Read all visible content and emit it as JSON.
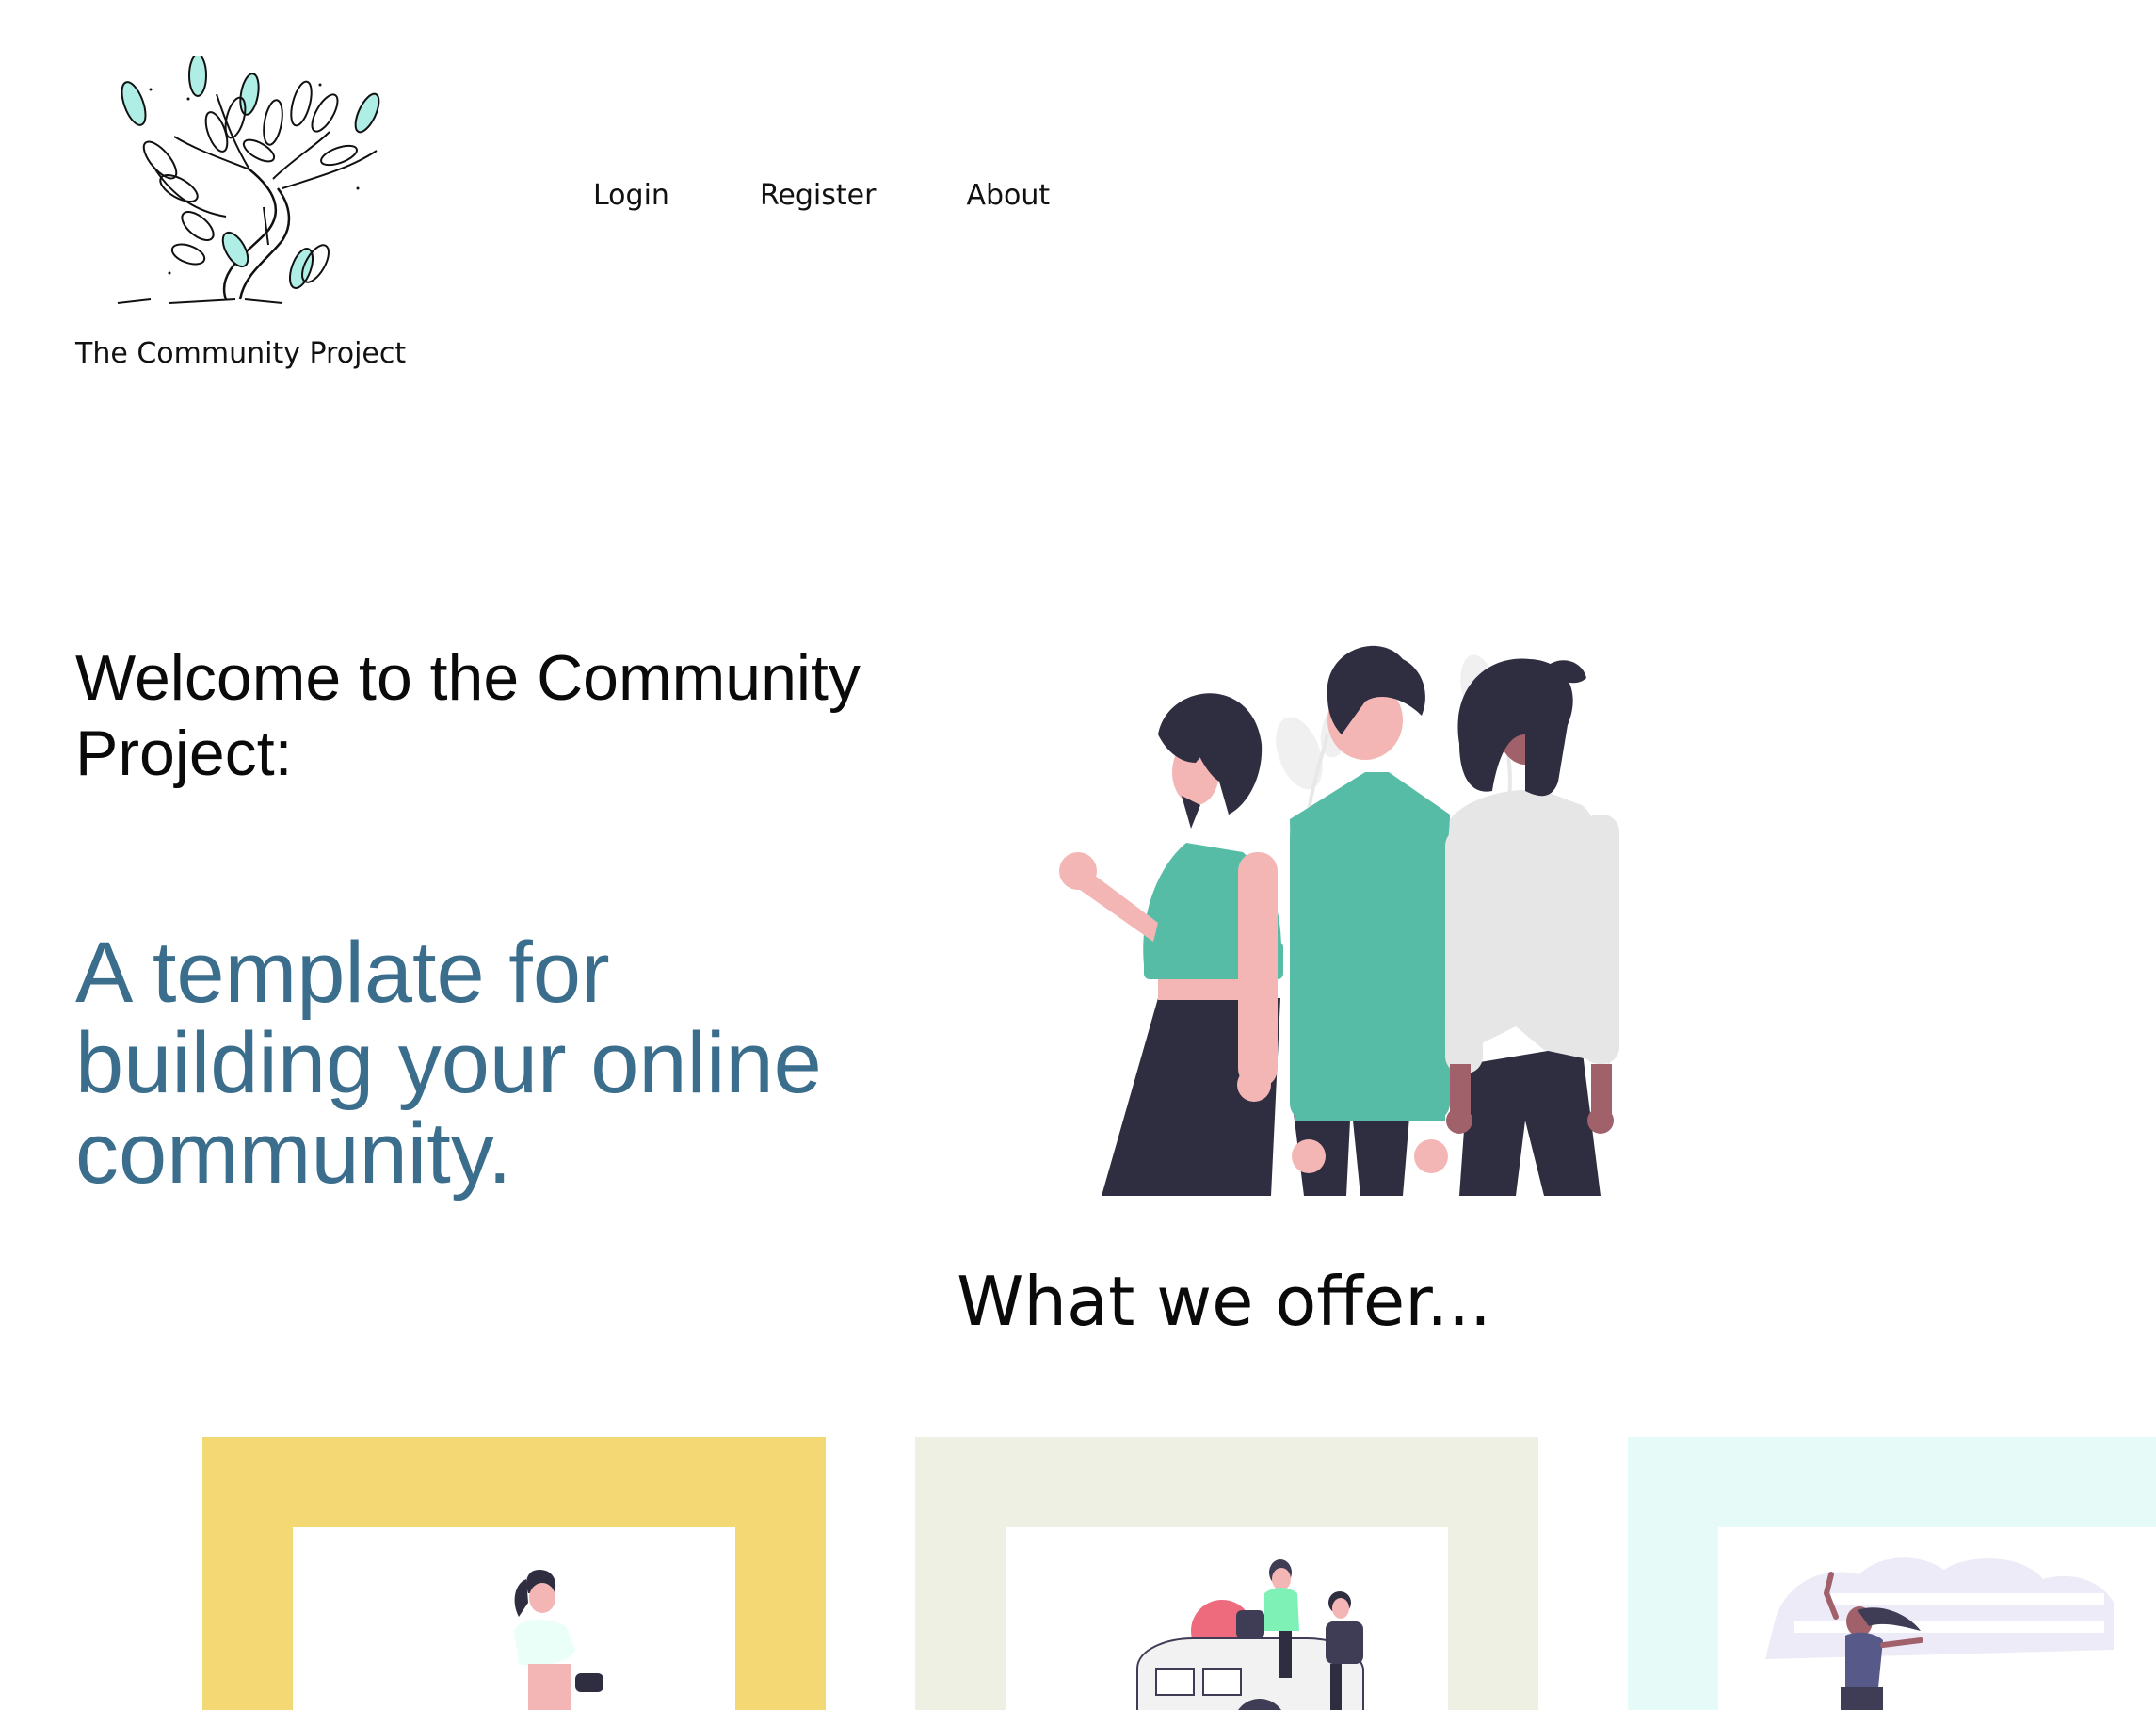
{
  "header": {
    "brand_name": "The Community Project",
    "logo_icon": "tree-sprout-logo",
    "nav": [
      {
        "label": "Login"
      },
      {
        "label": "Register"
      },
      {
        "label": "About"
      }
    ]
  },
  "hero": {
    "title": "Welcome to the Community Project:",
    "subtitle": "A template for building your online community.",
    "illustration": "three-people-standing"
  },
  "offer": {
    "title": "What we offer...",
    "cards": [
      {
        "color": "#f3d873",
        "illustration": "woman-with-gadget"
      },
      {
        "color": "#eef0e3",
        "illustration": "friends-on-car-trip"
      },
      {
        "color": "#e6fbf8",
        "illustration": "woman-jumping-joy"
      }
    ]
  },
  "colors": {
    "accent_text": "#3a6e8c",
    "shirt_green": "#57bca6",
    "dark": "#2f2e41",
    "skin": "#f4b6b4"
  }
}
